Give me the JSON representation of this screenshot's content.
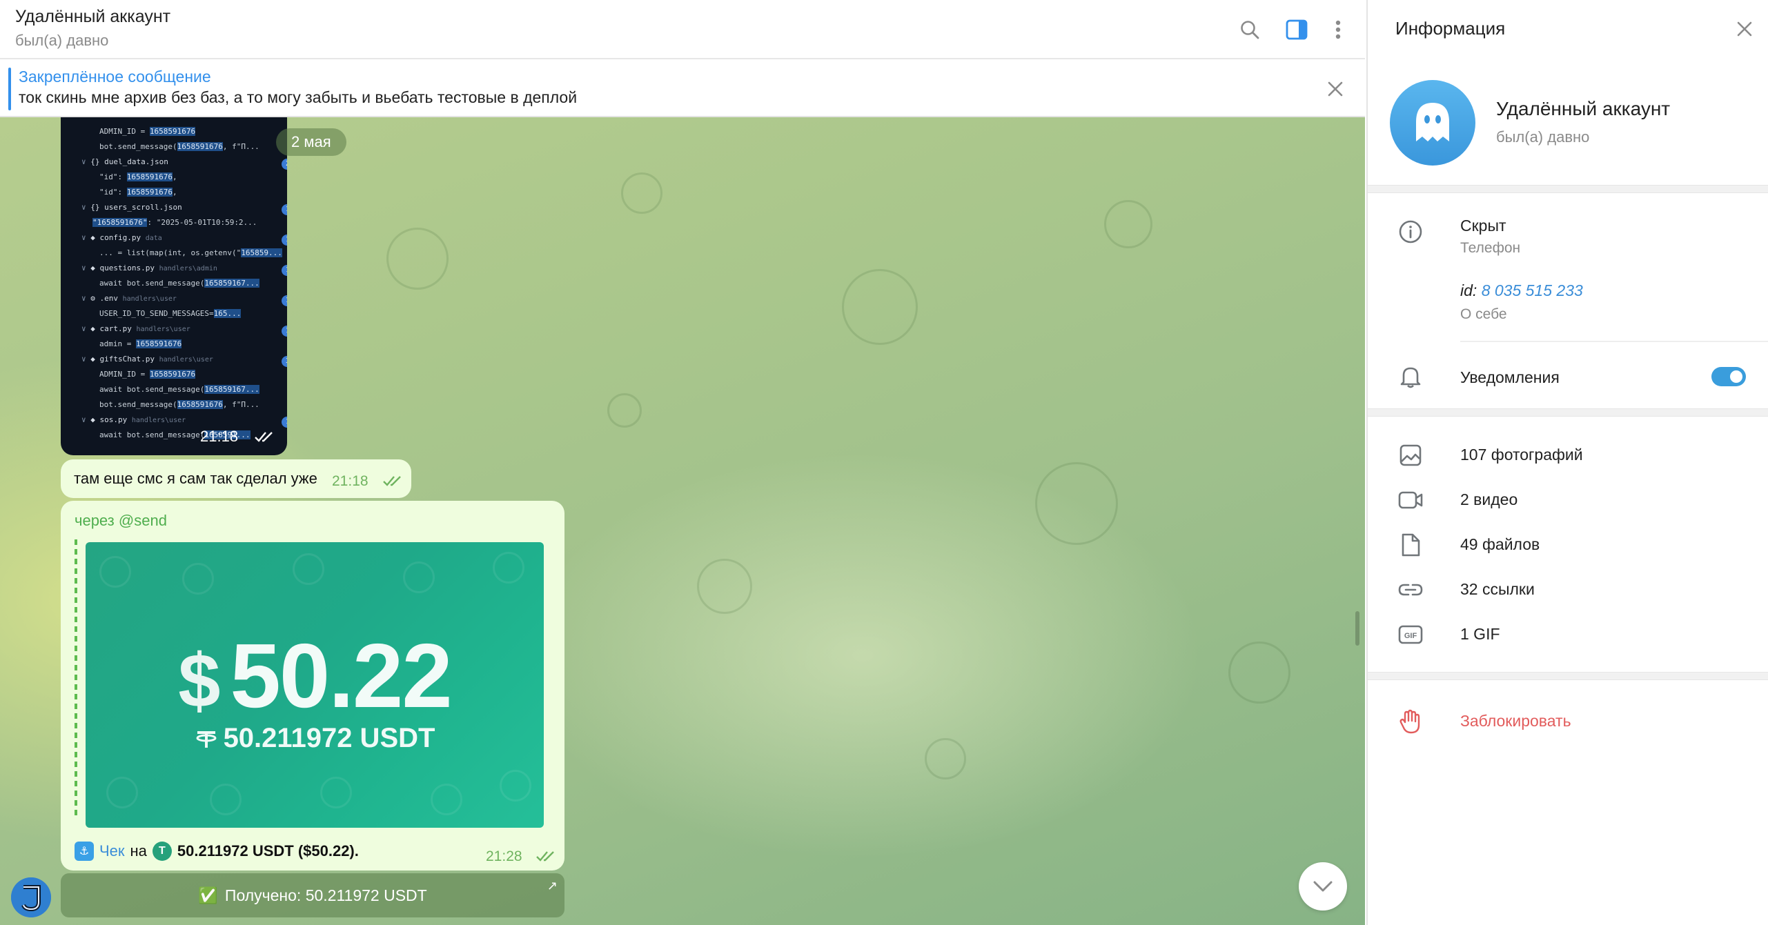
{
  "chat": {
    "header": {
      "title": "Удалённый аккаунт",
      "status": "был(а) давно",
      "icons": [
        "search-icon",
        "side-panel-icon",
        "more-vertical-icon"
      ]
    },
    "pinned": {
      "title": "Закреплённое сообщение",
      "text": "ток скинь мне архив без баз, а то могу забыть и вьебать тестовые в деплой"
    },
    "date_pill": "2 мая",
    "code_screenshot": {
      "time": "21:18",
      "lines": [
        {
          "indent": 2,
          "text": "ADMIN_ID = ",
          "hl": "1658591676"
        },
        {
          "indent": 2,
          "text": "bot.send_message(",
          "hl": "1658591676",
          "tail": ", f\"П..."
        },
        {
          "indent": 0,
          "arrow": "∨",
          "file": "{} duel_data.json",
          "count": "2"
        },
        {
          "indent": 2,
          "text": "\"id\": ",
          "hl": "1658591676",
          "tail": ","
        },
        {
          "indent": 2,
          "text": "\"id\": ",
          "hl": "1658591676",
          "tail": ","
        },
        {
          "indent": 0,
          "arrow": "∨",
          "file": "{} users_scroll.json",
          "count": "1"
        },
        {
          "indent": 1,
          "hl": "\"1658591676\"",
          "text": ": \"2025-05-01T10:59:2..."
        },
        {
          "indent": 0,
          "arrow": "∨",
          "file": "◆ config.py",
          "dim": "data",
          "count": "1"
        },
        {
          "indent": 2,
          "text": "... = list(map(int, os.getenv(\"",
          "hl": "165859..."
        },
        {
          "indent": 0,
          "arrow": "∨",
          "file": "◆ questions.py",
          "dim": "handlers\\admin",
          "count": "1"
        },
        {
          "indent": 2,
          "text": "await bot.send_message(",
          "hl": "165859167..."
        },
        {
          "indent": 0,
          "arrow": "∨",
          "file": "⚙ .env",
          "dim": "handlers\\user",
          "count": "1"
        },
        {
          "indent": 2,
          "text": "USER_ID_TO_SEND_MESSAGES=",
          "hl": "165..."
        },
        {
          "indent": 0,
          "arrow": "∨",
          "file": "◆ cart.py",
          "dim": "handlers\\user",
          "count": "1"
        },
        {
          "indent": 2,
          "text": "admin = ",
          "hl": "1658591676"
        },
        {
          "indent": 0,
          "arrow": "∨",
          "file": "◆ giftsChat.py",
          "dim": "handlers\\user",
          "count": "3"
        },
        {
          "indent": 2,
          "text": "ADMIN_ID = ",
          "hl": "1658591676"
        },
        {
          "indent": 2,
          "text": "await bot.send_message(",
          "hl": "165859167..."
        },
        {
          "indent": 2,
          "text": "bot.send_message(",
          "hl": "1658591676",
          "tail": ", f\"П..."
        },
        {
          "indent": 0,
          "arrow": "∨",
          "file": "◆ sos.py",
          "dim": "handlers\\user",
          "count": "1"
        },
        {
          "indent": 2,
          "text": "await bot.send_message(",
          "hl": "1658591..."
        }
      ]
    },
    "message_text": {
      "text": "там еще смс я сам так сделал уже",
      "time": "21:18"
    },
    "check_message": {
      "via_prefix": "через",
      "via_bot": "@send",
      "amount_currency": "$",
      "amount_value": "50.22",
      "usdt_line": "50.211972 USDT",
      "check_link": "Чек",
      "on_word": "на",
      "check_amount": "50.211972 USDT ($50.22).",
      "time": "21:28"
    },
    "bot_button": {
      "emoji": "✅",
      "label": "Получено: 50.211972 USDT"
    }
  },
  "info_panel": {
    "title": "Информация",
    "profile": {
      "name": "Удалённый аккаунт",
      "status": "был(а) давно"
    },
    "phone": {
      "value": "Скрыт",
      "label": "Телефон"
    },
    "id": {
      "prefix": "id:",
      "value": "8 035 515 233",
      "label": "О себе"
    },
    "notifications": {
      "label": "Уведомления",
      "enabled": true
    },
    "media": [
      {
        "icon": "photo-icon",
        "label": "107 фотографий"
      },
      {
        "icon": "video-icon",
        "label": "2 видео"
      },
      {
        "icon": "file-icon",
        "label": "49 файлов"
      },
      {
        "icon": "link-icon",
        "label": "32 ссылки"
      },
      {
        "icon": "gif-icon",
        "label": "1 GIF"
      }
    ],
    "block": {
      "label": "Заблокировать",
      "color": "#e25c5c"
    }
  },
  "colors": {
    "accent": "#3390ec",
    "bubble": "#effdde",
    "time_green": "#6fb35f",
    "tether_green": "#1fa989"
  }
}
